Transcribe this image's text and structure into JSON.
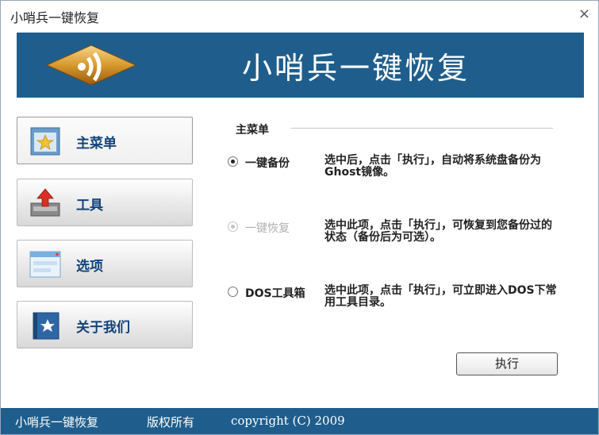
{
  "window": {
    "title": "小哨兵一键恢复",
    "close_glyph": "×"
  },
  "banner": {
    "title": "小哨兵一键恢复"
  },
  "sidebar": {
    "items": [
      {
        "label": "主菜单",
        "icon": "star-folder-icon",
        "active": true
      },
      {
        "label": "工具",
        "icon": "disk-upload-icon",
        "active": false
      },
      {
        "label": "选项",
        "icon": "window-options-icon",
        "active": false
      },
      {
        "label": "关于我们",
        "icon": "star-book-icon",
        "active": false
      }
    ]
  },
  "main": {
    "section_title": "主菜单",
    "options": [
      {
        "label": "一键备份",
        "desc": "选中后，点击「执行」，自动将系统盘备份为Ghost镜像。",
        "checked": true,
        "disabled": false
      },
      {
        "label": "一键恢复",
        "desc": "选中此项，点击「执行」，可恢复到您备份过的状态（备份后为可选）。",
        "checked": false,
        "disabled": true
      },
      {
        "label": "DOS工具箱",
        "desc": "选中此项，点击「执行」，可立即进入DOS下常用工具目录。",
        "checked": false,
        "disabled": false
      }
    ],
    "execute_label": "执行"
  },
  "footer": {
    "app_name": "小哨兵一键恢复",
    "rights": "版权所有",
    "copyright": "copyright (C) 2009"
  },
  "colors": {
    "banner": "#1f5e8c",
    "nav_text": "#12437a"
  }
}
